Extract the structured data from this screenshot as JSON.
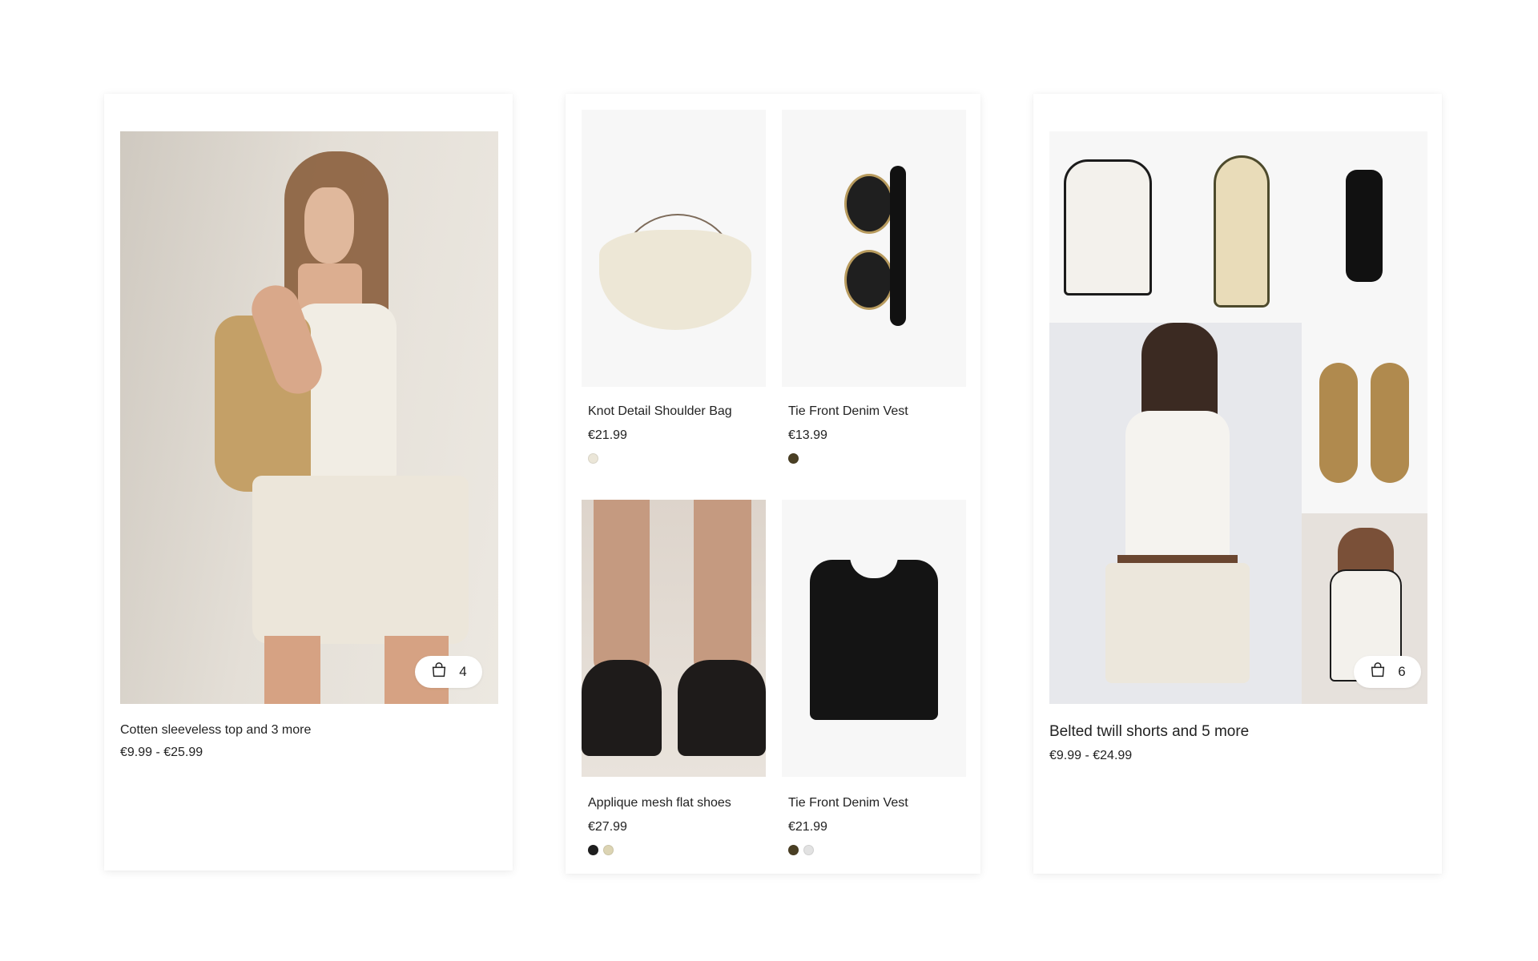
{
  "looks": [
    {
      "title": "Cotten sleeveless top and 3 more",
      "price": "€9.99 - €25.99",
      "bag_count": "4",
      "bag_icon": "shopping-bag-icon"
    },
    {
      "title": "Belted twill shorts and 5 more",
      "price": "€9.99 - €24.99",
      "bag_count": "6",
      "bag_icon": "shopping-bag-icon"
    }
  ],
  "products": [
    {
      "name": "Knot Detail Shoulder Bag",
      "price": "€21.99",
      "swatches": [
        "#ebe6d8"
      ]
    },
    {
      "name": "Tie Front Denim Vest",
      "price": "€13.99",
      "swatches": [
        "#4a3f24"
      ]
    },
    {
      "name": "Applique mesh flat shoes",
      "price": "€27.99",
      "swatches": [
        "#1f1f1f",
        "#dcd4b3"
      ]
    },
    {
      "name": "Tie Front Denim Vest",
      "price": "€21.99",
      "swatches": [
        "#4a3f24",
        "#e2e2e2"
      ]
    }
  ]
}
